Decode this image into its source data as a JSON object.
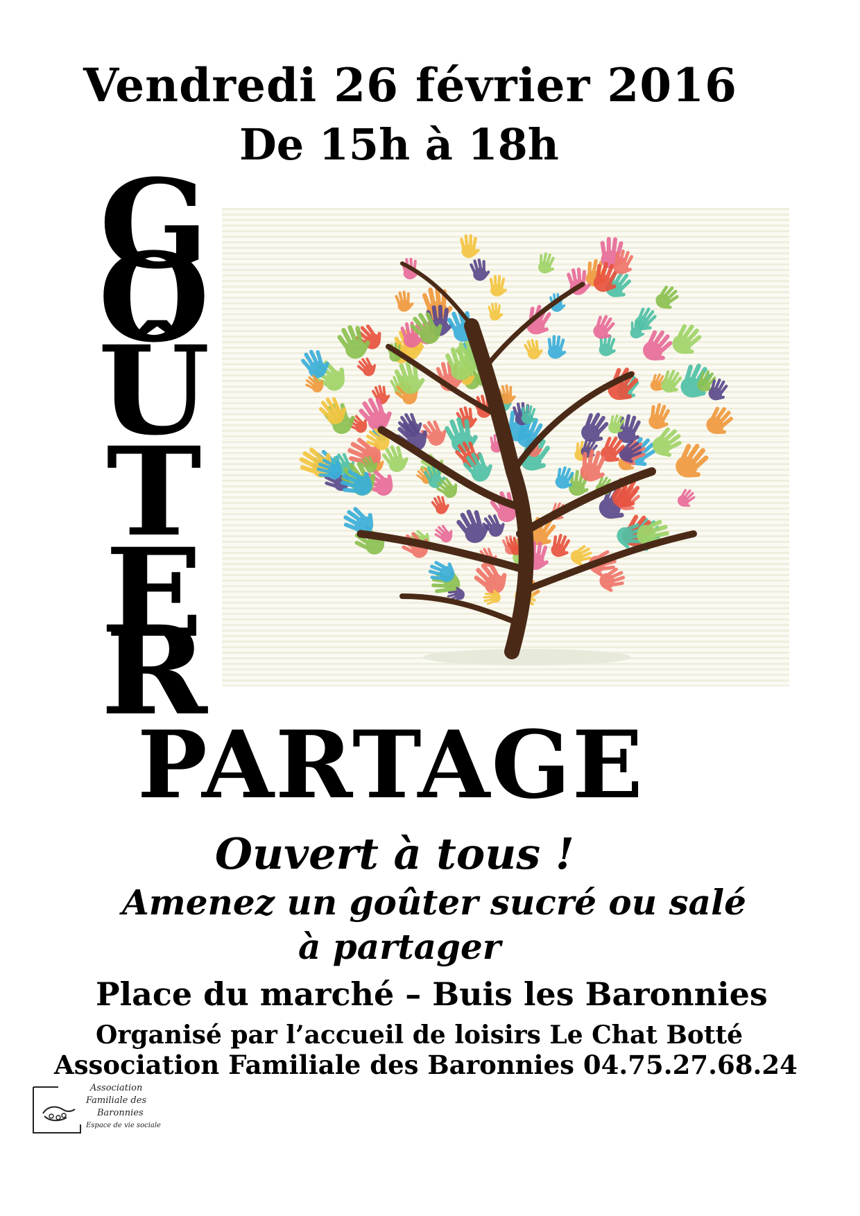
{
  "event": {
    "date": "Vendredi 26 février 2016",
    "hours": "De 15h à 18h",
    "vertical_title_letters": [
      "G",
      "O",
      "Û",
      "T",
      "E",
      "R"
    ],
    "subtitle": "PARTAGE"
  },
  "details": {
    "open": "Ouvert à tous !",
    "bring_line1": "Amenez un goûter sucré ou salé",
    "bring_line2": "à partager",
    "place": "Place du marché – Buis les Baronnies",
    "organizer_line1": "Organisé par l’accueil de loisirs Le Chat Botté",
    "organizer_line2": "Association Familiale des Baronnies 04.75.27.68.24"
  },
  "logo": {
    "line1": "Association",
    "line2": "Familiale des",
    "line3": "Baronnies",
    "tagline": "Espace de vie sociale"
  },
  "illustration": {
    "icon": "hand-tree-icon",
    "hand_colors": [
      "#e8533f",
      "#f19a3e",
      "#f4c542",
      "#8cc152",
      "#3bafda",
      "#4fc1a6",
      "#5b4a8b",
      "#e86c9a",
      "#f0766a",
      "#a0d468"
    ],
    "trunk_color": "#4a2a17"
  }
}
